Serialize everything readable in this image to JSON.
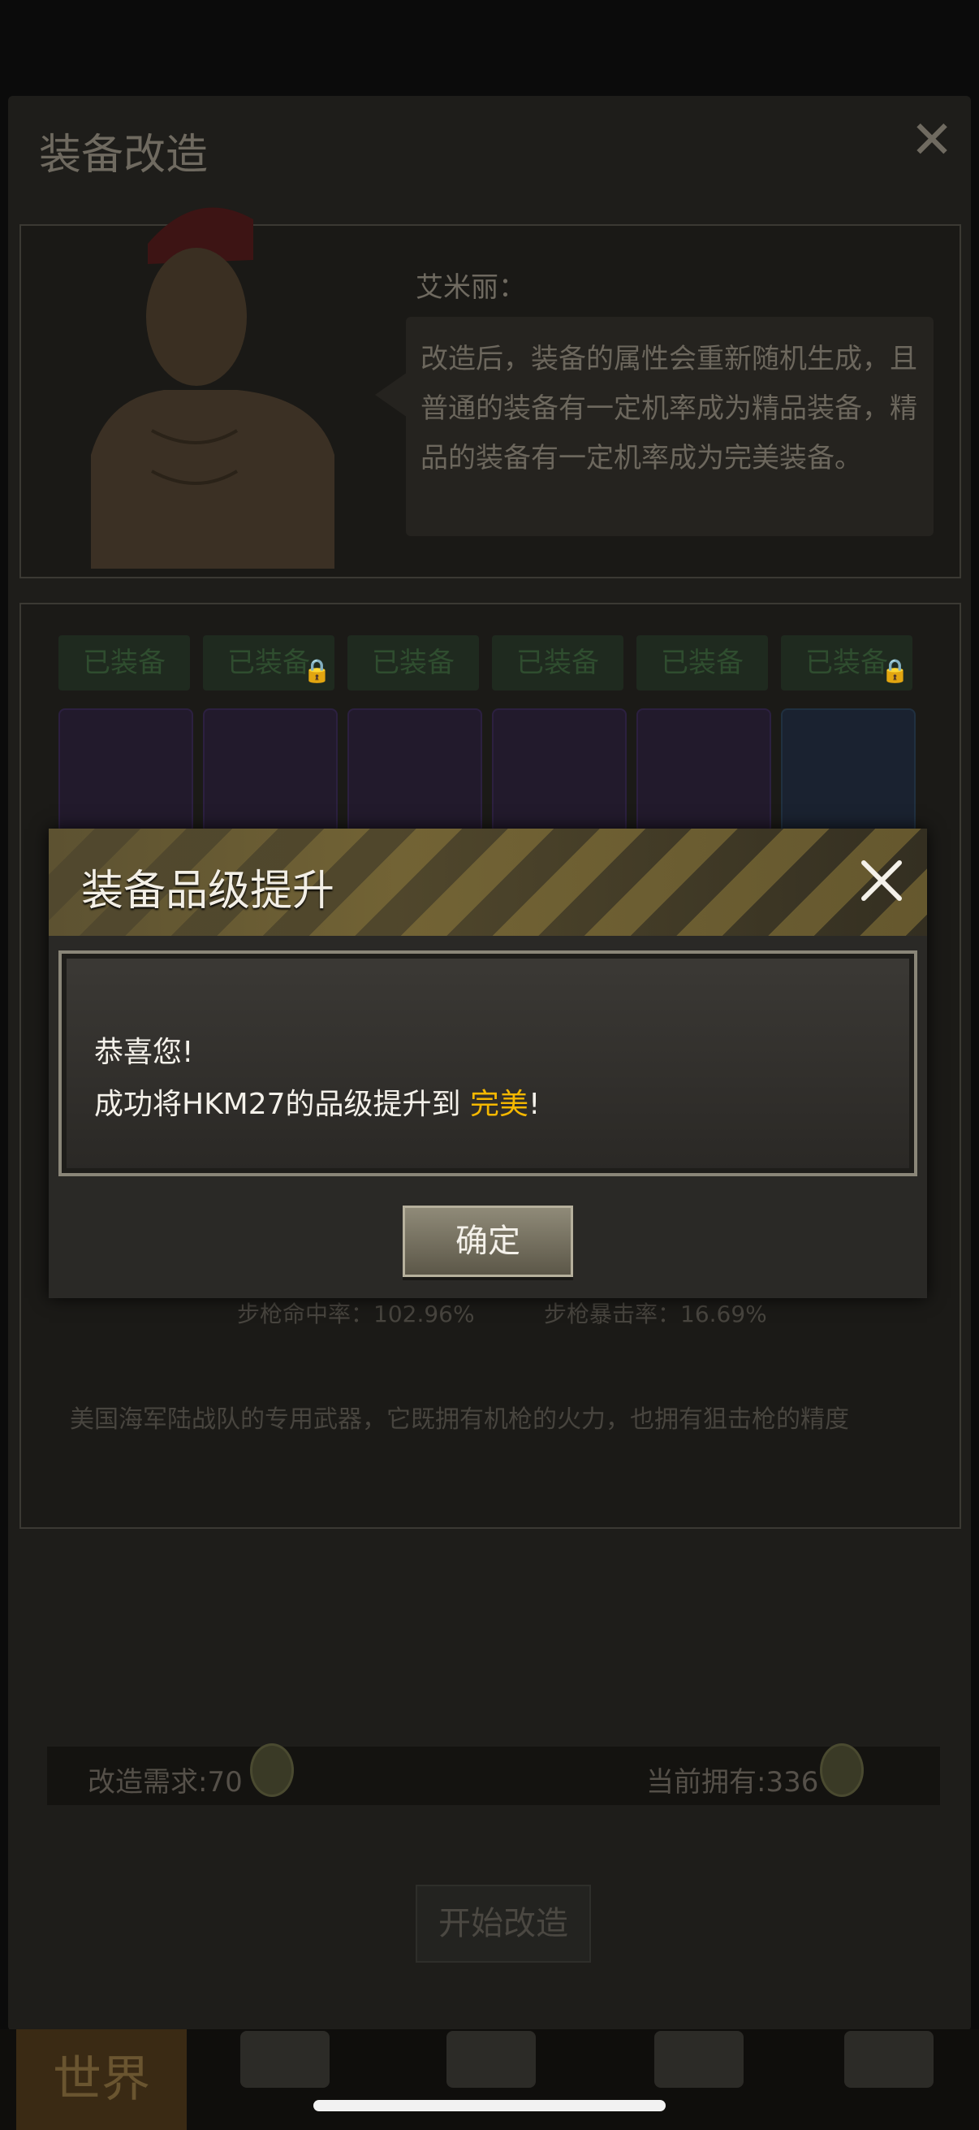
{
  "background": {
    "title": "装备改造",
    "npc_name": "艾米丽：",
    "npc_speech": "改造后，装备的属性会重新随机生成，且普通的装备有一定机率成为精品装备，精品的装备有一定机率成为完美装备。",
    "equip_tabs": [
      "已装备",
      "已装备",
      "已装备",
      "已装备",
      "已装备",
      "已装备"
    ],
    "stats": {
      "left": "步枪命中率：102.96%",
      "right": "步枪暴击率：16.69%"
    },
    "description": "美国海军陆战队的专用武器，它既拥有机枪的火力，也拥有狙击枪的精度",
    "cost_label": "改造需求:70",
    "owned_label": "当前拥有:336",
    "start_button": "开始改造",
    "nav_world": "世界"
  },
  "modal": {
    "title": "装备品级提升",
    "line1": "恭喜您!",
    "line2_prefix": "成功将HKM27的品级提升到 ",
    "line2_highlight": "完美",
    "line2_suffix": "!",
    "confirm": "确定"
  },
  "colors": {
    "highlight": "#f5b800",
    "modal_bg": "#2a2926"
  }
}
